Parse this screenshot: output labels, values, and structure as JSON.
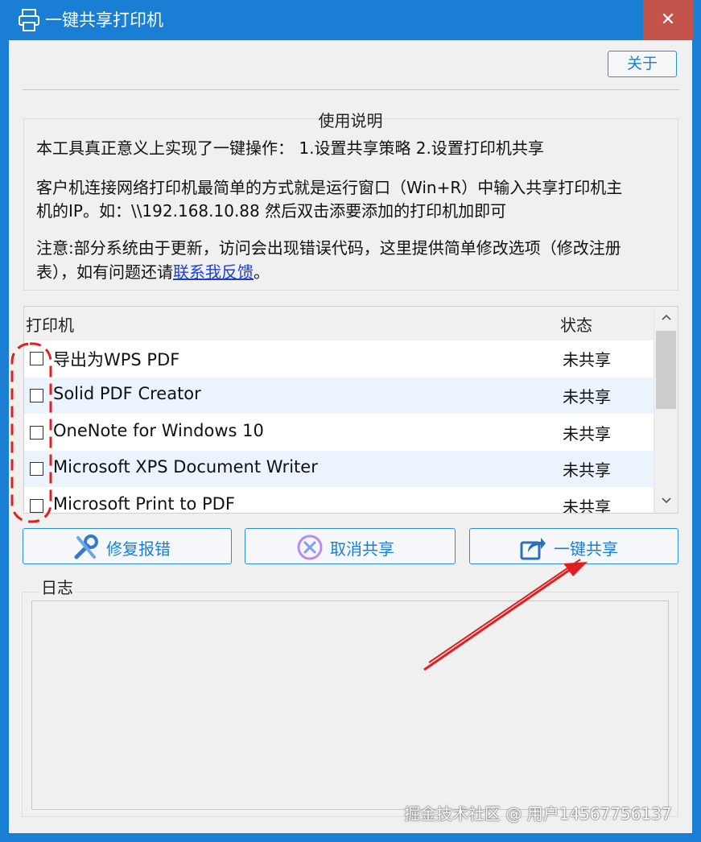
{
  "window": {
    "title": "一键共享打印机",
    "close_glyph": "✕"
  },
  "toolbar": {
    "about_label": "关于"
  },
  "usage": {
    "title": "使用说明",
    "line1": "本工具真正意义上实现了一键操作： 1.设置共享策略 2.设置打印机共享",
    "line2a": "客户机连接网络打印机最简单的方式就是运行窗口（Win+R）中输入共享打印机主",
    "line2b": "机的IP。如：\\\\192.168.10.88 然后双击添要添加的打印机加即可",
    "line3a": "注意:部分系统由于更新，访问会出现错误代码，这里提供简单修改选项（修改注册",
    "line3b_prefix": "表），如有问题还请",
    "line3b_link": "联系我反馈",
    "line3b_suffix": "。"
  },
  "printer_list": {
    "header_name": "打印机",
    "header_status": "状态",
    "rows": [
      {
        "name": "导出为WPS PDF",
        "status": "未共享",
        "checked": false
      },
      {
        "name": "Solid PDF Creator",
        "status": "未共享",
        "checked": false
      },
      {
        "name": "OneNote for Windows 10",
        "status": "未共享",
        "checked": false
      },
      {
        "name": "Microsoft XPS Document Writer",
        "status": "未共享",
        "checked": false
      },
      {
        "name": "Microsoft Print to PDF",
        "status": "未共享",
        "checked": false
      }
    ]
  },
  "actions": {
    "repair_label": "修复报错",
    "cancel_share_label": "取消共享",
    "one_click_share_label": "一键共享"
  },
  "log": {
    "label": "日志"
  },
  "watermark": "掘金技术社区 @ 用户14567756137",
  "colors": {
    "accent": "#1a7fd4",
    "close": "#c4534b",
    "annotation": "#e02020",
    "row_alt": "#ebf4fd"
  },
  "icons": {
    "app": "printer-icon",
    "repair": "wrench-icon",
    "cancel": "cancel-circle-icon",
    "share": "share-arrow-icon",
    "scroll_up": "chevron-up-icon",
    "scroll_down": "chevron-down-icon"
  }
}
